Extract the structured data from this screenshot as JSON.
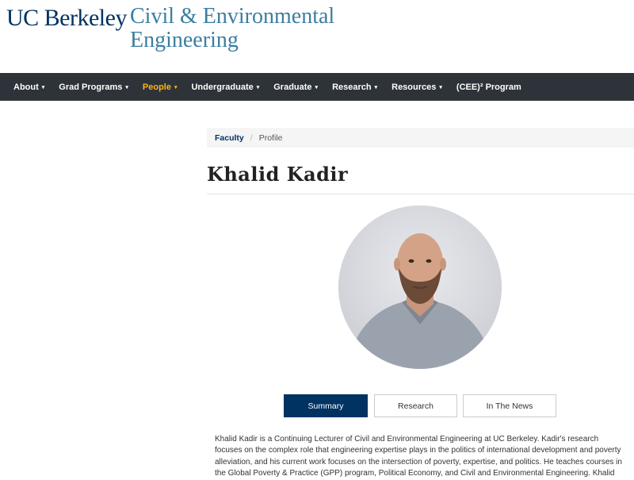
{
  "header": {
    "university": "UC Berkeley",
    "department_line1": "Civil & Environmental",
    "department_line2": "Engineering"
  },
  "nav": {
    "items": [
      {
        "label": "About",
        "has_dropdown": true
      },
      {
        "label": "Grad Programs",
        "has_dropdown": true
      },
      {
        "label": "People",
        "has_dropdown": true,
        "active": true
      },
      {
        "label": "Undergraduate",
        "has_dropdown": true
      },
      {
        "label": "Graduate",
        "has_dropdown": true
      },
      {
        "label": "Research",
        "has_dropdown": true
      },
      {
        "label": "Resources",
        "has_dropdown": true
      },
      {
        "label": "(CEE)² Program",
        "has_dropdown": false
      }
    ],
    "caret": "▾"
  },
  "breadcrumb": {
    "parent": "Faculty",
    "separator": "/",
    "current": "Profile"
  },
  "profile": {
    "name": "Khalid Kadir"
  },
  "tabs": {
    "summary": "Summary",
    "research": "Research",
    "news": "In The News",
    "active": "summary"
  },
  "bio": {
    "text": "Khalid Kadir is a Continuing Lecturer of Civil and Environmental Engineering at UC Berkeley. Kadir's research focuses on the complex role that engineering expertise plays in the politics of international development and poverty alleviation, and his current work focuses on the intersection of poverty, expertise, and politics. He teaches courses in the Global Poverty & Practice (GPP) program, Political Economy, and Civil and Environmental Engineering. Khalid was"
  },
  "colors": {
    "berkeley_blue": "#003262",
    "founders_rock": "#3B7EA1",
    "california_gold": "#FDB515",
    "nav_bg": "#2d3339"
  }
}
